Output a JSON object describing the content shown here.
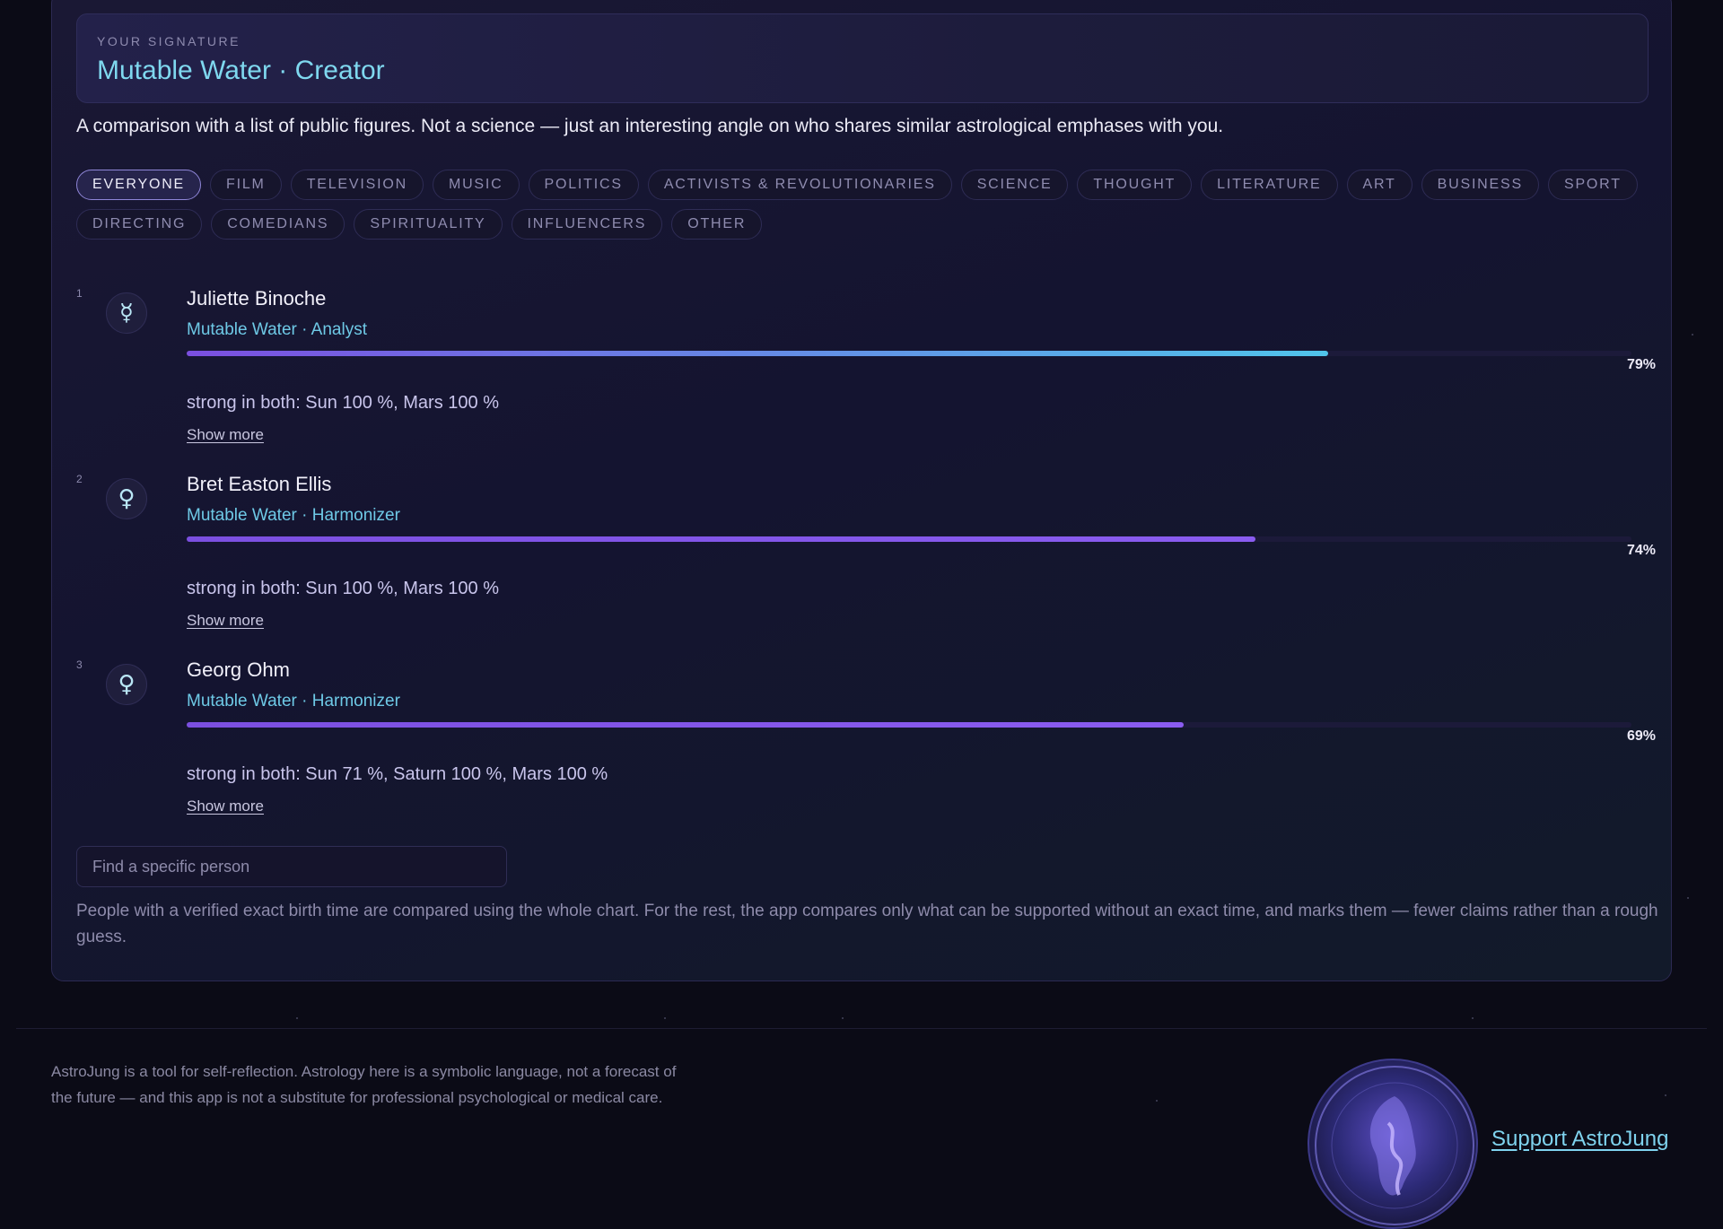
{
  "signature": {
    "label": "YOUR SIGNATURE",
    "value": "Mutable Water · Creator"
  },
  "intro_text": "A comparison with a list of public figures. Not a science — just an interesting angle on who shares similar astrological emphases with you.",
  "filters": [
    "Everyone",
    "Film",
    "Television",
    "Music",
    "Politics",
    "Activists & Revolutionaries",
    "Science",
    "Thought",
    "Literature",
    "Art",
    "Business",
    "Sport",
    "Directing",
    "Comedians",
    "Spirituality",
    "Influencers",
    "Other"
  ],
  "active_filter": "Everyone",
  "matches": [
    {
      "rank": "1",
      "icon": "mercury-icon",
      "glyph": "☿",
      "name": "Juliette Binoche",
      "type": "Mutable Water · Analyst",
      "percent_label": "79%",
      "percent": 79,
      "strong_in_both": "strong in both: Sun 100 %, Mars 100 %",
      "show_more": "Show more",
      "bar_colors": [
        "#7b4fe0",
        "#50c4ea"
      ]
    },
    {
      "rank": "2",
      "icon": "venus-icon",
      "glyph": "♀",
      "name": "Bret Easton Ellis",
      "type": "Mutable Water · Harmonizer",
      "percent_label": "74%",
      "percent": 74,
      "strong_in_both": "strong in both: Sun 100 %, Mars 100 %",
      "show_more": "Show more",
      "bar_colors": [
        "#7b4fe0",
        "#8a5cf0"
      ]
    },
    {
      "rank": "3",
      "icon": "venus-icon",
      "glyph": "♀",
      "name": "Georg Ohm",
      "type": "Mutable Water · Harmonizer",
      "percent_label": "69%",
      "percent": 69,
      "strong_in_both": "strong in both: Sun 71 %, Saturn 100 %, Mars 100 %",
      "show_more": "Show more",
      "bar_colors": [
        "#7b4fe0",
        "#8a5cf0"
      ]
    }
  ],
  "search": {
    "placeholder": "Find a specific person"
  },
  "note": "People with a verified exact birth time are compared using the whole chart. For the rest, the app compares only what can be supported without an exact time, and marks them — fewer claims rather than a rough guess.",
  "footer": {
    "disclaimer": "AstroJung is a tool for self-reflection. Astrology here is a symbolic language, not a forecast of the future — and this app is not a substitute for professional psychological or medical care.",
    "support_link": "Support AstroJung"
  }
}
